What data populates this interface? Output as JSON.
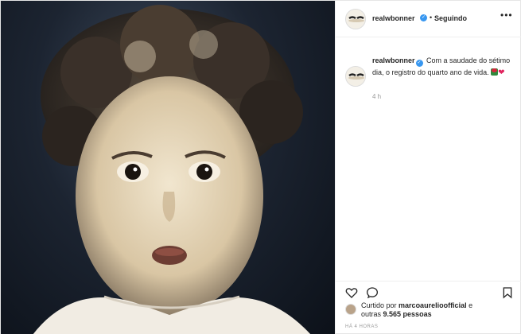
{
  "post": {
    "username": "realwbonner",
    "follow_status": "Seguindo",
    "dot": "•",
    "more_glyph": "•••",
    "caption_username": "realwbonner",
    "caption_text": "Com a saudade do sétimo dia, o registro do quarto ano de vida.",
    "caption_emojis": [
      "rose-emoji",
      "heart-emoji"
    ],
    "heart_glyph": "❤",
    "time_ago": "4 h",
    "liked_by_label": "Curtido por",
    "liked_by_user": "marcoaurelioofficial",
    "liked_by_joiner": "e",
    "others_prefix": "outras",
    "others_count": "9.565 pessoas",
    "post_time": "HÁ 4 HORAS"
  },
  "icons": {
    "verified": "verified-badge-icon",
    "like": "heart-outline-icon",
    "comment": "speech-bubble-icon",
    "save": "bookmark-icon",
    "more": "ellipsis-icon"
  },
  "colors": {
    "verified": "#3897f0",
    "text": "#262626",
    "muted": "#999999",
    "border": "#efefef"
  }
}
